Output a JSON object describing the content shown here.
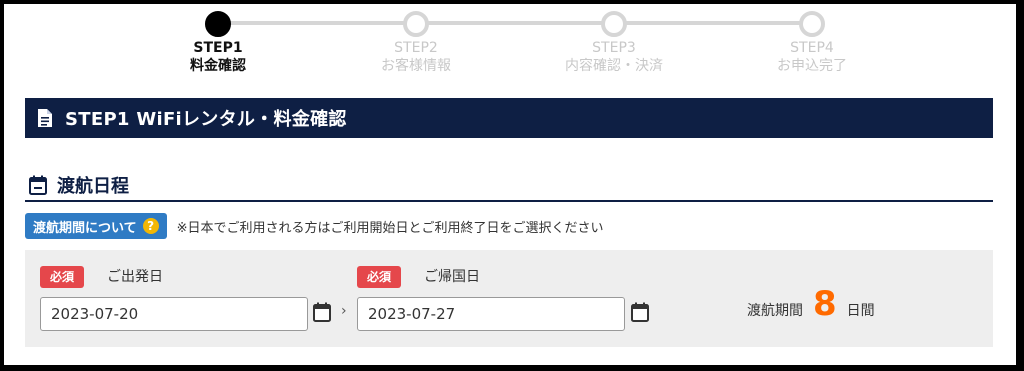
{
  "stepper": {
    "steps": [
      {
        "step": "STEP1",
        "label": "料金確認",
        "active": true
      },
      {
        "step": "STEP2",
        "label": "お客様情報",
        "active": false
      },
      {
        "step": "STEP3",
        "label": "内容確認・決済",
        "active": false
      },
      {
        "step": "STEP4",
        "label": "お申込完了",
        "active": false
      }
    ]
  },
  "title_bar": {
    "title": "STEP1 WiFiレンタル・料金確認",
    "icon": "document-icon",
    "bg_color": "#0e1f44"
  },
  "section": {
    "heading": "渡航日程",
    "icon": "calendar-icon"
  },
  "about": {
    "badge_label": "渡航期間について",
    "help_symbol": "?",
    "note": "※日本でご利用される方はご利用開始日とご利用終了日をご選択ください"
  },
  "form": {
    "required_label": "必須",
    "departure": {
      "label": "ご出発日",
      "value": "2023-07-20"
    },
    "arrow": "›",
    "return": {
      "label": "ご帰国日",
      "value": "2023-07-27"
    },
    "duration": {
      "label": "渡航期間",
      "days": "8",
      "unit": "日間"
    }
  },
  "colors": {
    "accent_orange": "#ff6a00",
    "required_red": "#e5474b",
    "badge_blue": "#2f7bc4"
  }
}
